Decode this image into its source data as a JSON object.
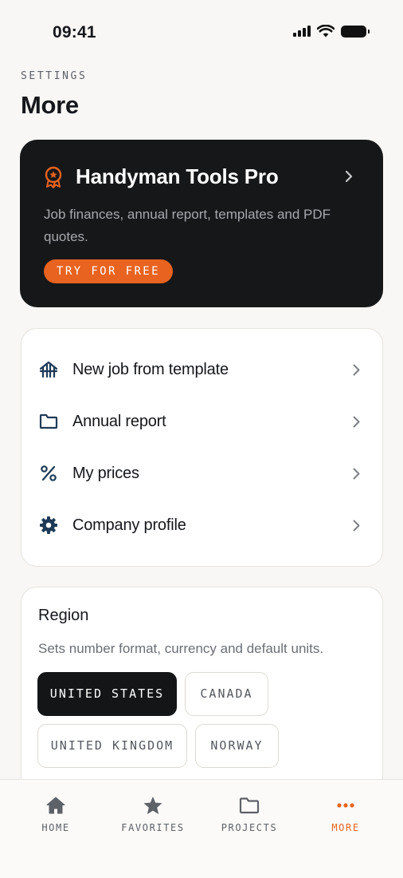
{
  "status_bar": {
    "time": "09:41"
  },
  "header": {
    "eyebrow": "SETTINGS",
    "title": "More"
  },
  "promo": {
    "title": "Handyman Tools Pro",
    "description": "Job finances, annual report, templates and PDF quotes.",
    "cta_label": "TRY FOR FREE",
    "icon": "award-ribbon-icon",
    "accent_color": "#e8631f"
  },
  "menu": {
    "items": [
      {
        "label": "New job from template",
        "icon": "template-house-icon"
      },
      {
        "label": "Annual report",
        "icon": "folder-icon"
      },
      {
        "label": "My prices",
        "icon": "percent-icon"
      },
      {
        "label": "Company profile",
        "icon": "gear-icon"
      }
    ]
  },
  "region": {
    "title": "Region",
    "description": "Sets number format, currency and default units.",
    "options": [
      "UNITED STATES",
      "CANADA",
      "UNITED KINGDOM",
      "NORWAY"
    ],
    "selected": "UNITED STATES"
  },
  "tab_bar": {
    "tabs": [
      {
        "label": "HOME",
        "icon": "home-icon"
      },
      {
        "label": "FAVORITES",
        "icon": "star-icon"
      },
      {
        "label": "PROJECTS",
        "icon": "folder-icon"
      },
      {
        "label": "MORE",
        "icon": "more-dots-icon"
      }
    ],
    "active": "MORE",
    "active_color": "#e8631f",
    "icon_color": "#5d6168"
  }
}
